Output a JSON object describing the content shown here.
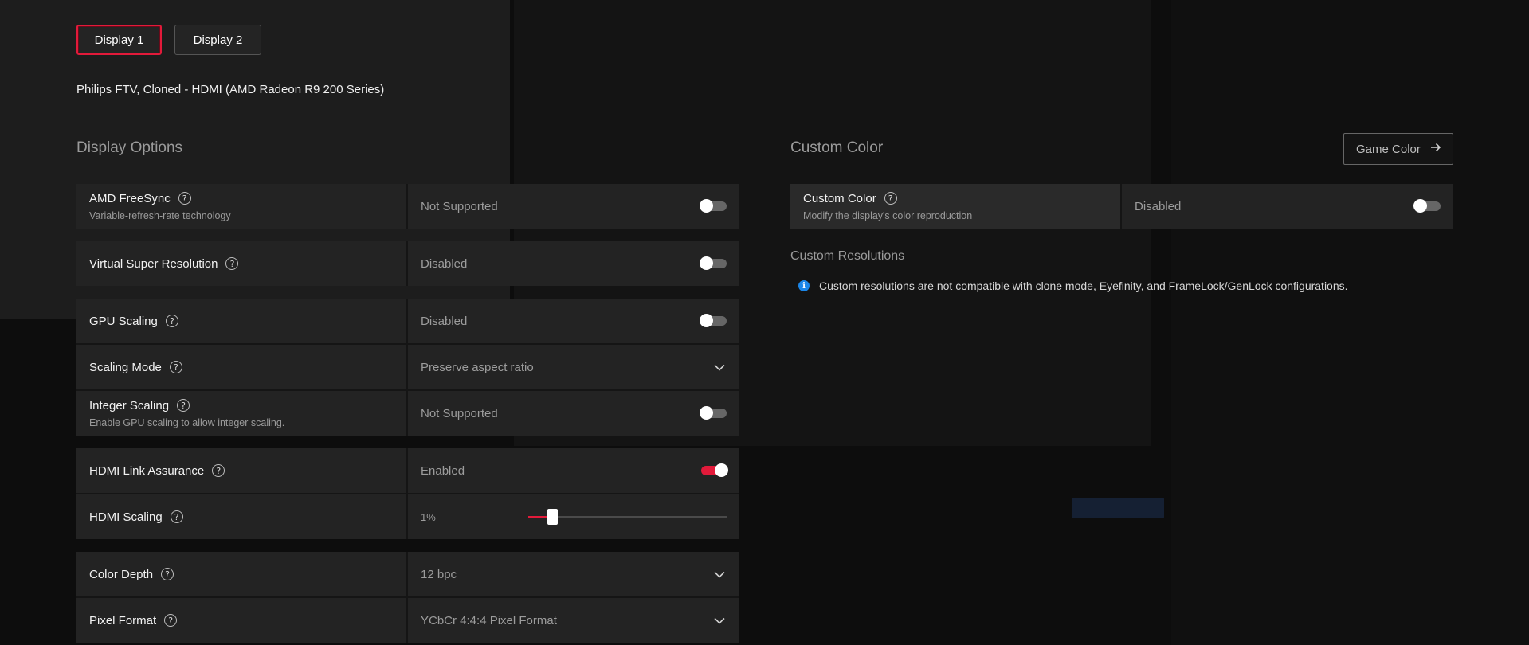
{
  "tabs": [
    {
      "label": "Display 1",
      "active": true
    },
    {
      "label": "Display 2",
      "active": false
    }
  ],
  "display_info": "Philips FTV, Cloned - HDMI (AMD Radeon R9 200 Series)",
  "display_options": {
    "title": "Display Options",
    "freesync": {
      "label": "AMD FreeSync",
      "description": "Variable-refresh-rate technology",
      "value": "Not Supported",
      "enabled": false
    },
    "vsr": {
      "label": "Virtual Super Resolution",
      "value": "Disabled",
      "enabled": false
    },
    "gpu_scaling": {
      "label": "GPU Scaling",
      "value": "Disabled",
      "enabled": false
    },
    "scaling_mode": {
      "label": "Scaling Mode",
      "value": "Preserve aspect ratio"
    },
    "integer_scaling": {
      "label": "Integer Scaling",
      "description": "Enable GPU scaling to allow integer scaling.",
      "value": "Not Supported",
      "enabled": false
    },
    "hdmi_link": {
      "label": "HDMI Link Assurance",
      "value": "Enabled",
      "enabled": true
    },
    "hdmi_scaling": {
      "label": "HDMI Scaling",
      "value": "1%",
      "level": 0.1
    },
    "color_depth": {
      "label": "Color Depth",
      "value": "12 bpc"
    },
    "pixel_format": {
      "label": "Pixel Format",
      "value": "YCbCr 4:4:4 Pixel Format"
    }
  },
  "custom_color": {
    "title": "Custom Color",
    "game_color_button": "Game Color",
    "row": {
      "label": "Custom Color",
      "description": "Modify the display's color reproduction",
      "value": "Disabled",
      "enabled": false
    }
  },
  "custom_resolutions": {
    "title": "Custom Resolutions",
    "info": "Custom resolutions are not compatible with clone mode, Eyefinity, and FrameLock/GenLock configurations."
  },
  "colors": {
    "accent": "#e21a3a",
    "info": "#1b86e8",
    "panel": "#232323",
    "background": "#0d0d0d"
  },
  "icons": {
    "help": "question-circle-icon",
    "chevron": "chevron-down-icon",
    "arrow": "arrow-right-icon",
    "info": "info-icon"
  }
}
